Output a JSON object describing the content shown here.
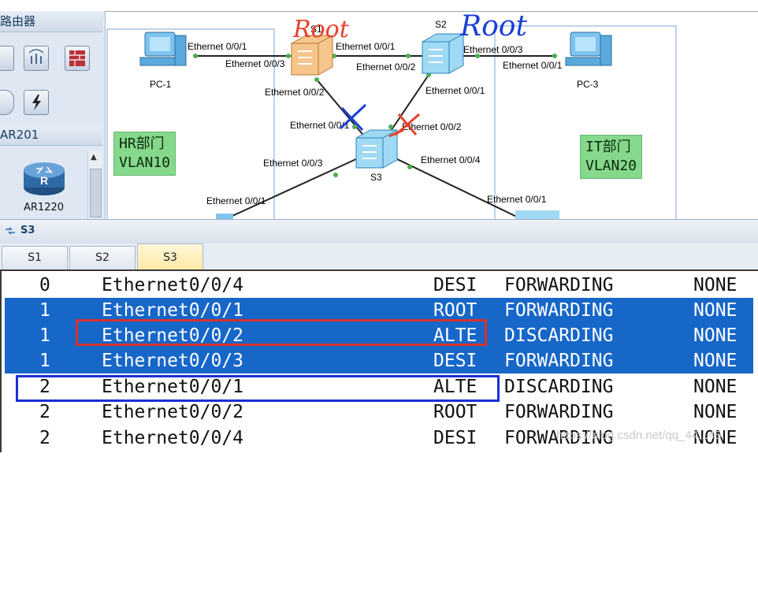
{
  "left_panel": {
    "header_top": "路由器",
    "header_mid": "AR201",
    "device_label": "AR1220",
    "device_icon_letter": "R"
  },
  "topology": {
    "devices": {
      "pc1": "PC-1",
      "pc3": "PC-3",
      "s1": "S1",
      "s2": "S2",
      "s3": "S3"
    },
    "port_labels": {
      "pc1_port": "Ethernet 0/0/1",
      "s1_to_pc1": "Ethernet 0/0/3",
      "s2_to_s1": "Ethernet 0/0/1",
      "s1_to_s2": "Ethernet 0/0/2",
      "s2_to_pc3": "Ethernet 0/0/3",
      "pc3_port": "Ethernet 0/0/1",
      "s1_down": "Ethernet 0/0/2",
      "s2_down": "Ethernet 0/0/1",
      "s3_to_s1": "Ethernet 0/0/1",
      "s3_to_s2": "Ethernet 0/0/2",
      "s3_left": "Ethernet 0/0/3",
      "s3_right": "Ethernet 0/0/4",
      "bottom_left": "Ethernet 0/0/1",
      "bottom_right": "Ethernet 0/0/1"
    },
    "vlan_hr": "HR部门\nVLAN10",
    "vlan_it": "IT部门\nVLAN20",
    "annotation_root_red": "Root",
    "annotation_root_blue": "Root"
  },
  "window": {
    "title": "S3"
  },
  "tabs": [
    {
      "label": "S1",
      "active": false
    },
    {
      "label": "S2",
      "active": false
    },
    {
      "label": "S3",
      "active": true
    }
  ],
  "stp_table": [
    {
      "inst": "0",
      "port": "Ethernet0/0/4",
      "role": "DESI",
      "state": "FORWARDING",
      "prot": "NONE",
      "selected": false
    },
    {
      "inst": "1",
      "port": "Ethernet0/0/1",
      "role": "ROOT",
      "state": "FORWARDING",
      "prot": "NONE",
      "selected": true
    },
    {
      "inst": "1",
      "port": "Ethernet0/0/2",
      "role": "ALTE",
      "state": "DISCARDING",
      "prot": "NONE",
      "selected": true
    },
    {
      "inst": "1",
      "port": "Ethernet0/0/3",
      "role": "DESI",
      "state": "FORWARDING",
      "prot": "NONE",
      "selected": true
    },
    {
      "inst": "2",
      "port": "Ethernet0/0/1",
      "role": "ALTE",
      "state": "DISCARDING",
      "prot": "NONE",
      "selected": false
    },
    {
      "inst": "2",
      "port": "Ethernet0/0/2",
      "role": "ROOT",
      "state": "FORWARDING",
      "prot": "NONE",
      "selected": false
    },
    {
      "inst": "2",
      "port": "Ethernet0/0/4",
      "role": "DESI",
      "state": "FORWARDING",
      "prot": "NONE",
      "selected": false
    }
  ],
  "watermark": "https://blog.csdn.net/qq_44...45",
  "colors": {
    "selection": "#1767c9",
    "annotation_red": "#d8312a",
    "annotation_blue": "#1a2fd6",
    "vlan_box": "#86d88c"
  }
}
